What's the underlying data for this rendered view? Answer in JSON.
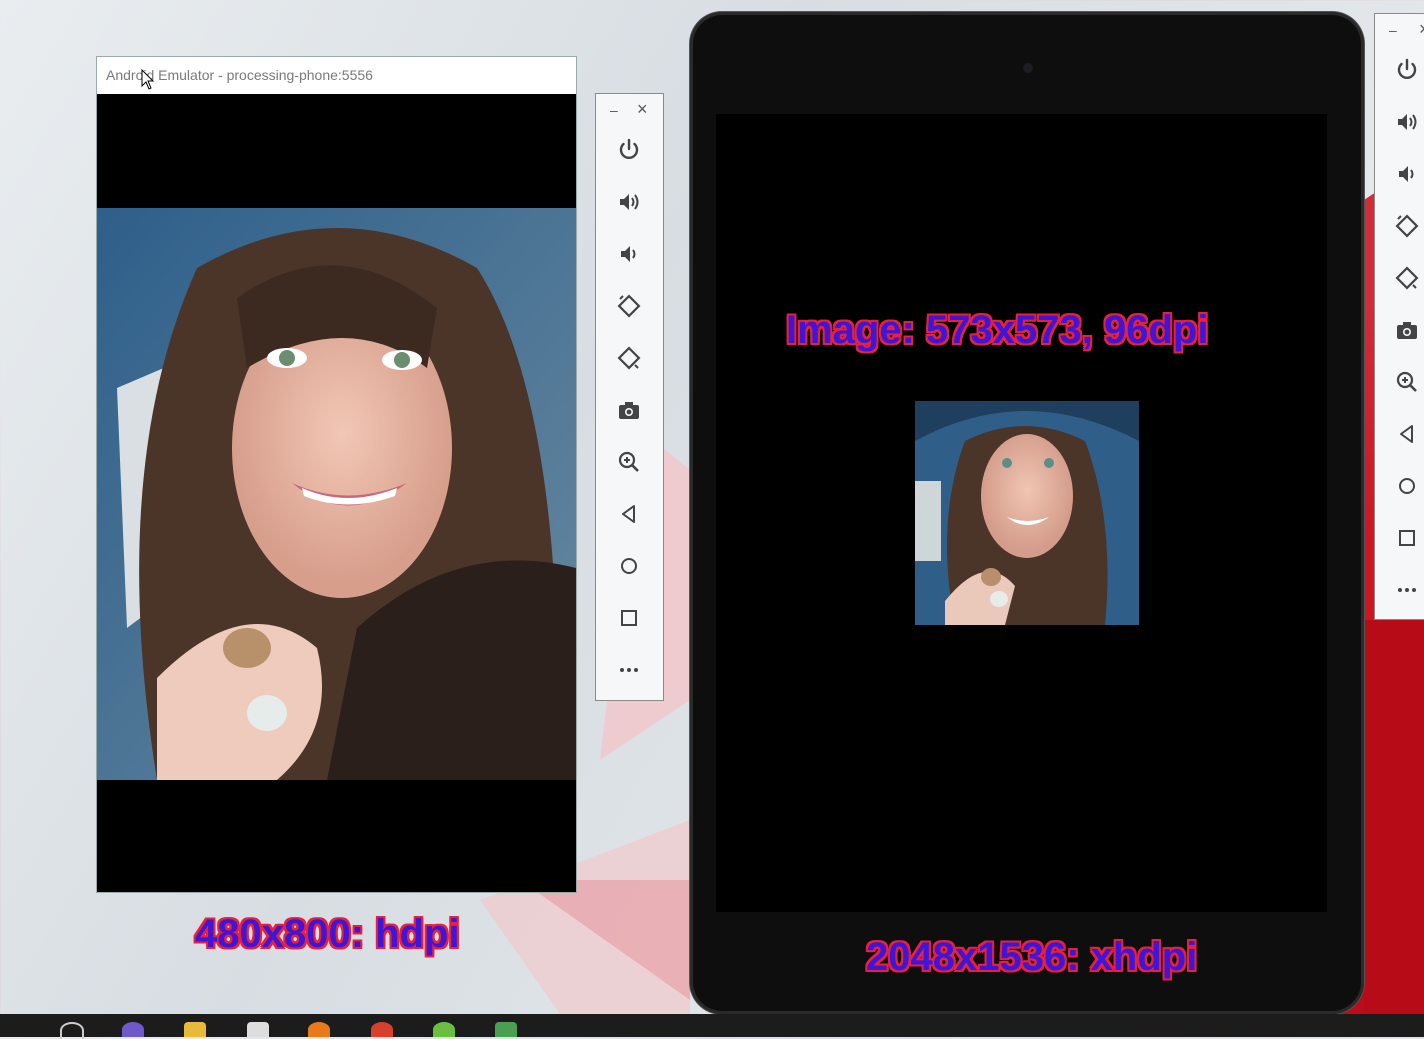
{
  "emulator1": {
    "title": "Android Emulator - processing-phone:5556",
    "resolution_label": "480x800: hdpi"
  },
  "toolbar": {
    "minimize": "–",
    "close": "×",
    "buttons": [
      {
        "name": "power-icon"
      },
      {
        "name": "volume-up-icon"
      },
      {
        "name": "volume-down-icon"
      },
      {
        "name": "rotate-left-icon"
      },
      {
        "name": "rotate-right-icon"
      },
      {
        "name": "camera-icon"
      },
      {
        "name": "zoom-icon"
      },
      {
        "name": "back-icon"
      },
      {
        "name": "home-icon"
      },
      {
        "name": "overview-icon"
      },
      {
        "name": "more-icon"
      }
    ]
  },
  "tablet": {
    "image_caption": "Image: 573x573, 96dpi",
    "resolution_label": "2048x1536: xhdpi"
  },
  "colors": {
    "label_fill": "#3e16d8",
    "label_outline": "#e8203a",
    "wallpaper_red": "#c8101e"
  }
}
